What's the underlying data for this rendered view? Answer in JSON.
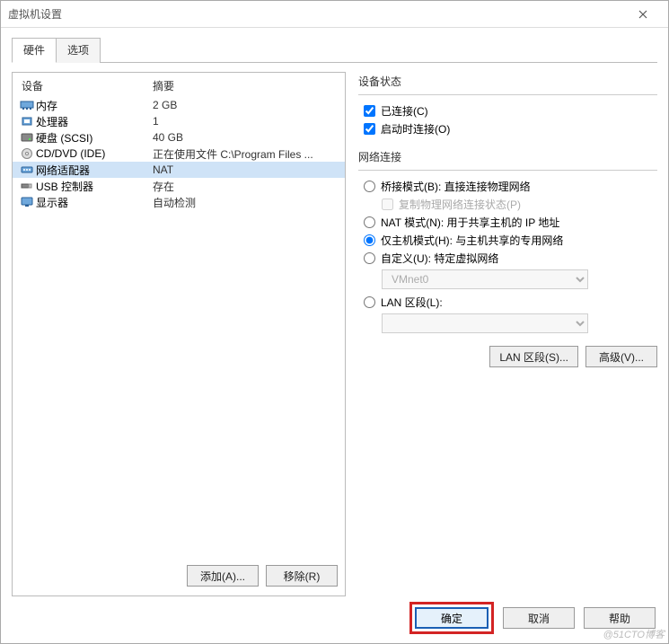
{
  "window": {
    "title": "虚拟机设置"
  },
  "tabs": {
    "hardware": "硬件",
    "options": "选项"
  },
  "hw": {
    "col_device": "设备",
    "col_summary": "摘要",
    "rows": [
      {
        "name": "内存",
        "summary": "2 GB",
        "icon": "memory"
      },
      {
        "name": "处理器",
        "summary": "1",
        "icon": "cpu"
      },
      {
        "name": "硬盘 (SCSI)",
        "summary": "40 GB",
        "icon": "disk"
      },
      {
        "name": "CD/DVD (IDE)",
        "summary": "正在使用文件 C:\\Program Files ...",
        "icon": "cd"
      },
      {
        "name": "网络适配器",
        "summary": "NAT",
        "icon": "net"
      },
      {
        "name": "USB 控制器",
        "summary": "存在",
        "icon": "usb"
      },
      {
        "name": "显示器",
        "summary": "自动检测",
        "icon": "display"
      }
    ],
    "add_btn": "添加(A)...",
    "remove_btn": "移除(R)"
  },
  "right": {
    "group_status": "设备状态",
    "connected": "已连接(C)",
    "connect_on": "启动时连接(O)",
    "group_net": "网络连接",
    "bridge": "桥接模式(B): 直接连接物理网络",
    "replicate": "复制物理网络连接状态(P)",
    "nat": "NAT 模式(N): 用于共享主机的 IP 地址",
    "hostonly": "仅主机模式(H): 与主机共享的专用网络",
    "custom": "自定义(U): 特定虚拟网络",
    "vmnet": "VMnet0",
    "lanseg_radio": "LAN 区段(L):",
    "lanseg_btn": "LAN 区段(S)...",
    "advanced_btn": "高级(V)..."
  },
  "footer": {
    "ok": "确定",
    "cancel": "取消",
    "help": "帮助",
    "watermark": "@51CTO博客"
  }
}
